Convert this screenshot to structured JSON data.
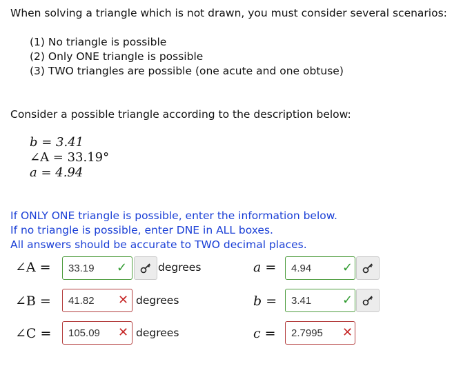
{
  "intro": {
    "heading": "When solving a triangle which is not drawn, you must consider several scenarios:",
    "scenarios": [
      "(1) No triangle is possible",
      "(2) Only ONE triangle is possible",
      "(3) TWO triangles are possible (one acute and one obtuse)"
    ]
  },
  "problem": {
    "prompt": "Consider a possible triangle according to the description below:",
    "givens": [
      "b = 3.41",
      "∠A = 33.19°",
      "a = 4.94"
    ]
  },
  "instructions": [
    "If ONLY ONE triangle is possible, enter the information below.",
    "If no triangle is possible, enter DNE in ALL boxes.",
    "All answers should be accurate to TWO decimal places."
  ],
  "answers": {
    "angleA": {
      "label": "∠A =",
      "value": "33.19",
      "status": "correct",
      "unit": "degrees"
    },
    "angleB": {
      "label": "∠B =",
      "value": "41.82",
      "status": "incorrect",
      "unit": "degrees"
    },
    "angleC": {
      "label": "∠C =",
      "value": "105.09",
      "status": "incorrect",
      "unit": "degrees"
    },
    "sideA": {
      "label": "a =",
      "value": "4.94",
      "status": "correct"
    },
    "sideB": {
      "label": "b =",
      "value": "3.41",
      "status": "correct"
    },
    "sideC": {
      "label": "c =",
      "value": "2.7995",
      "status": "incorrect"
    }
  },
  "icons": {
    "correct": "checkmark-icon",
    "incorrect": "x-mark-icon",
    "key": "key-icon"
  },
  "colors": {
    "correct": "#2e9a2e",
    "incorrect": "#c62828",
    "instruction": "#1a3fd6"
  }
}
